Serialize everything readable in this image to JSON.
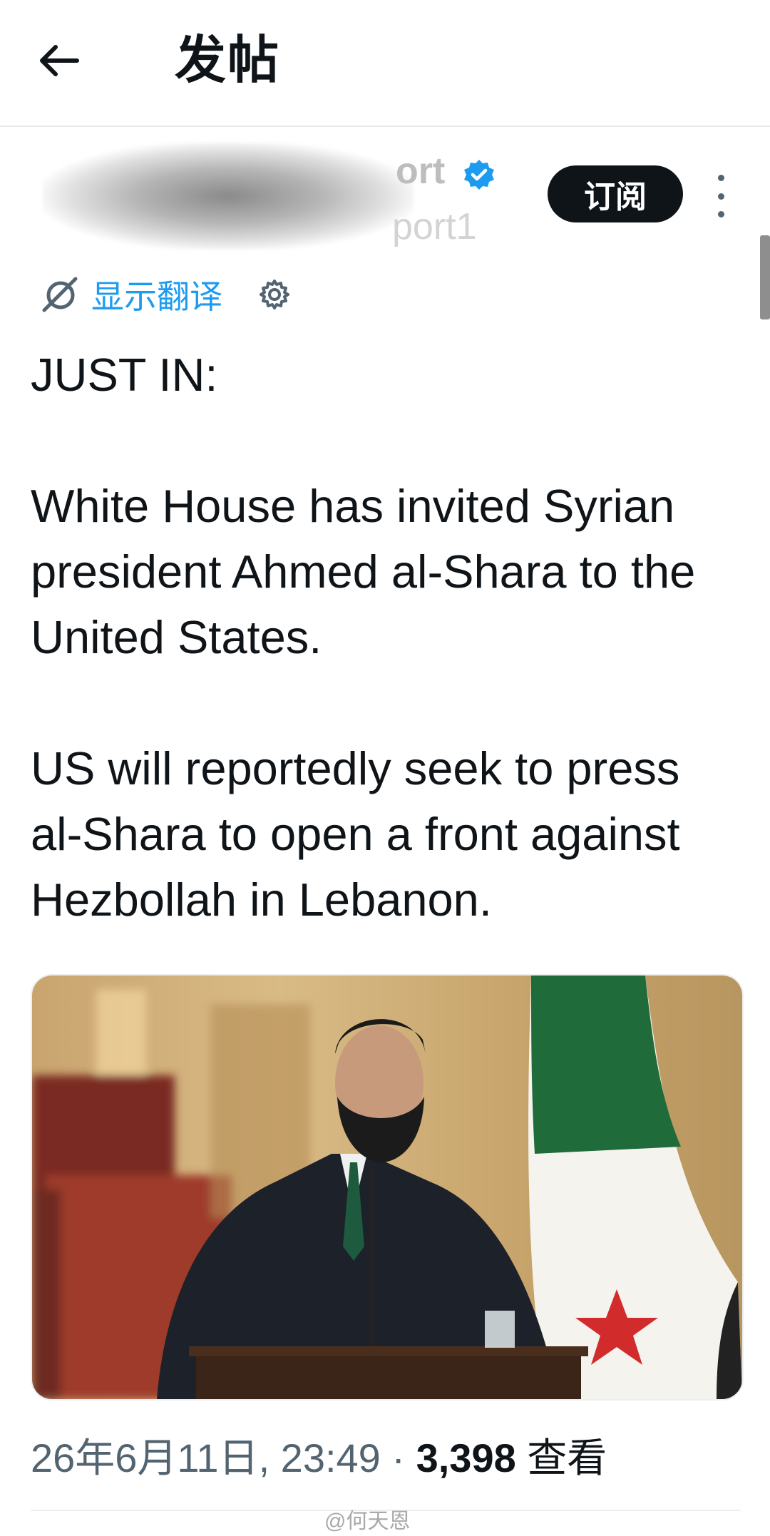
{
  "header": {
    "title": "发帖",
    "back_icon": "arrow-left-icon"
  },
  "author": {
    "name_visible": "ort",
    "handle_visible": "port1",
    "verified_icon": "verified-badge-icon",
    "verified_color": "#1d9bf0"
  },
  "actions": {
    "subscribe_label": "订阅",
    "more_icon": "more-vertical-icon"
  },
  "translate": {
    "icon": "translate-icon",
    "label": "显示翻译",
    "settings_icon": "gear-icon",
    "accent": "#1d9bf0"
  },
  "post": {
    "line1": "JUST IN:",
    "paragraph2": "White House has invited Syrian president Ahmed al-Shara to the United States.",
    "paragraph3": "US will reportedly seek to press al-Shara to open a front against Hezbollah in Lebanon."
  },
  "media": {
    "kind": "photo",
    "subject": "man in dark suit at podium with green-white-black flag with red stars"
  },
  "meta": {
    "timestamp": "26年6月11日, 23:49",
    "separator": " · ",
    "views_count": "3,398",
    "views_label": "查看"
  },
  "watermark": "@何天恩"
}
